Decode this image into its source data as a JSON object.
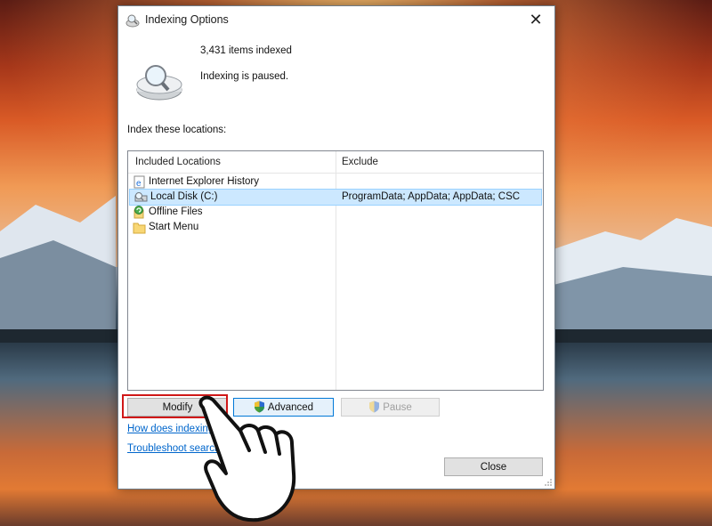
{
  "dialog": {
    "title": "Indexing Options",
    "items_indexed": "3,431 items indexed",
    "status": "Indexing is paused.",
    "section_label": "Index these locations:"
  },
  "listview": {
    "columns": [
      "Included Locations",
      "Exclude"
    ],
    "rows": [
      {
        "name": "Internet Explorer History",
        "exclude": "",
        "icon": "ie-history-icon",
        "selected": false
      },
      {
        "name": "Local Disk (C:)",
        "exclude": "ProgramData; AppData; AppData; CSC",
        "icon": "local-disk-icon",
        "selected": true
      },
      {
        "name": "Offline Files",
        "exclude": "",
        "icon": "offline-files-icon",
        "selected": false
      },
      {
        "name": "Start Menu",
        "exclude": "",
        "icon": "folder-icon",
        "selected": false
      }
    ]
  },
  "buttons": {
    "modify": "Modify",
    "advanced": "Advanced",
    "pause": "Pause",
    "close": "Close"
  },
  "links": {
    "how_indexing": "How does indexing",
    "troubleshoot": "Troubleshoot search a"
  },
  "colors": {
    "highlight_border": "#d01818",
    "selected_row": "#cce8ff",
    "link": "#0066cc"
  }
}
